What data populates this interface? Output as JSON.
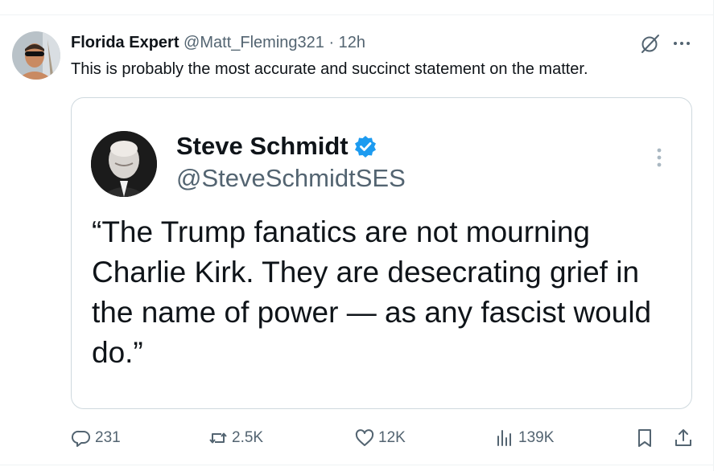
{
  "post": {
    "author_name": "Florida Expert",
    "author_handle": "@Matt_Fleming321",
    "separator": "·",
    "timestamp": "12h",
    "text": "This is probably the most accurate and succinct statement on the matter."
  },
  "quoted": {
    "author_name": "Steve Schmidt",
    "author_handle": "@SteveSchmidtSES",
    "verified": true,
    "text": "“The Trump fanatics are not mourning Charlie Kirk. They are desecrating grief in the name of power — as any fascist would do.”"
  },
  "actions": {
    "replies": "231",
    "reposts": "2.5K",
    "likes": "12K",
    "views": "139K"
  },
  "icons": [
    "grok-icon",
    "more-icon",
    "verified-icon",
    "reply-icon",
    "repost-icon",
    "like-icon",
    "views-icon",
    "bookmark-icon",
    "share-icon"
  ],
  "colors": {
    "text": "#0f1419",
    "secondary": "#536471",
    "border": "#cfd9de",
    "verified": "#1d9bf0"
  }
}
